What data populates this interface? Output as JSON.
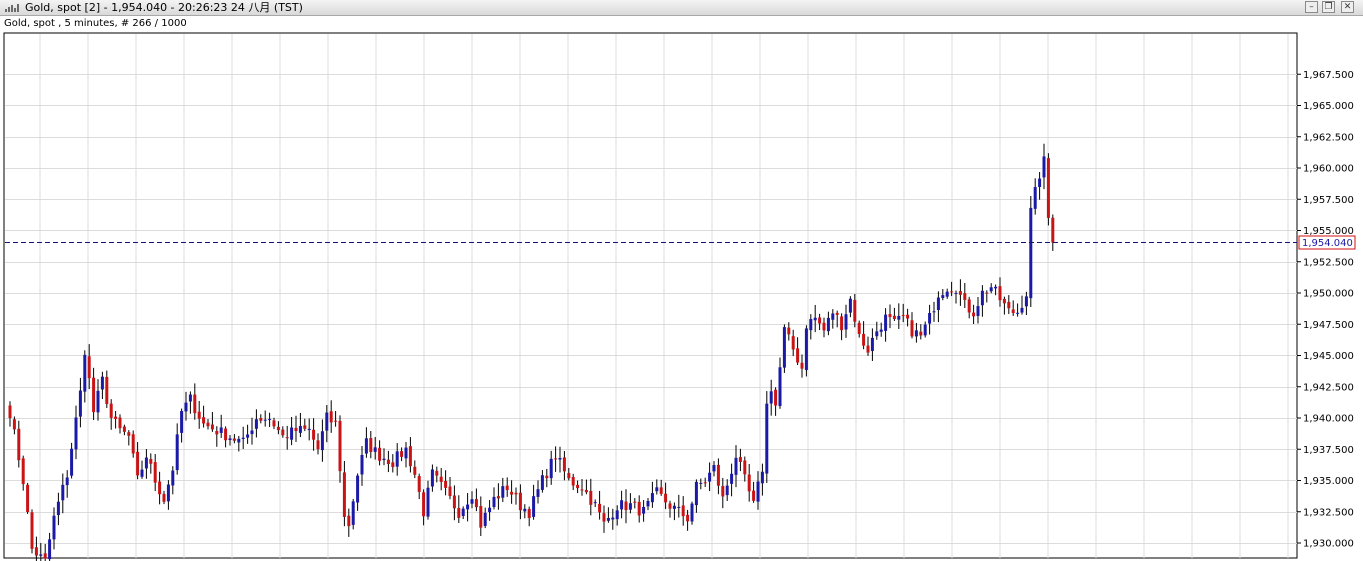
{
  "window": {
    "title": "Gold, spot [2] - 1,954.040 - 20:26:23  24 八月 (TST)",
    "buttons": {
      "minimize": "–",
      "restore": "❐",
      "close": "✕"
    }
  },
  "chart_info": "Gold, spot , 5 minutes, # 266 / 1000",
  "colors": {
    "up": "#1a1aa6",
    "down": "#c81414",
    "grid": "#dcdcdc",
    "last_line": "#14146e",
    "last_label": "#d01010"
  },
  "chart_data": {
    "type": "candlestick",
    "instrument": "Gold, spot",
    "timeframe": "5 minutes",
    "ylim": [
      1928.8,
      1970.8
    ],
    "y_ticks": [
      1930.0,
      1932.5,
      1935.0,
      1937.5,
      1940.0,
      1942.5,
      1945.0,
      1947.5,
      1950.0,
      1952.5,
      1955.0,
      1957.5,
      1960.0,
      1962.5,
      1965.0,
      1967.5
    ],
    "y_tick_labels": [
      "1,930.000",
      "1,932.500",
      "1,935.000",
      "1,937.500",
      "1,940.000",
      "1,942.500",
      "1,945.000",
      "1,947.500",
      "1,950.000",
      "1,952.500",
      "1,955.000",
      "1,957.500",
      "1,960.000",
      "1,962.500",
      "1,965.000",
      "1,967.500"
    ],
    "last_price": 1954.04,
    "last_price_label": "1,954.040",
    "grid": true,
    "checkpoints": [
      [
        0,
        1940.5
      ],
      [
        3,
        1935.0
      ],
      [
        5,
        1929.5
      ],
      [
        8,
        1928.5
      ],
      [
        10,
        1932.0
      ],
      [
        13,
        1935.5
      ],
      [
        16,
        1942.0
      ],
      [
        17,
        1945.5
      ],
      [
        19,
        1940.5
      ],
      [
        21,
        1943.0
      ],
      [
        23,
        1940.0
      ],
      [
        25,
        1939.0
      ],
      [
        27,
        1938.5
      ],
      [
        29,
        1935.0
      ],
      [
        31,
        1937.0
      ],
      [
        33,
        1935.0
      ],
      [
        35,
        1933.5
      ],
      [
        37,
        1936.0
      ],
      [
        39,
        1940.5
      ],
      [
        41,
        1941.5
      ],
      [
        44,
        1939.5
      ],
      [
        47,
        1939.0
      ],
      [
        50,
        1938.5
      ],
      [
        53,
        1938.0
      ],
      [
        56,
        1940.0
      ],
      [
        59,
        1940.0
      ],
      [
        62,
        1938.5
      ],
      [
        65,
        1939.0
      ],
      [
        68,
        1939.0
      ],
      [
        70,
        1937.5
      ],
      [
        72,
        1940.0
      ],
      [
        74,
        1939.5
      ],
      [
        75,
        1936.0
      ],
      [
        76,
        1932.0
      ],
      [
        77,
        1931.5
      ],
      [
        79,
        1935.5
      ],
      [
        81,
        1938.0
      ],
      [
        84,
        1937.0
      ],
      [
        87,
        1936.5
      ],
      [
        90,
        1937.5
      ],
      [
        92,
        1935.5
      ],
      [
        94,
        1932.5
      ],
      [
        96,
        1935.5
      ],
      [
        99,
        1934.0
      ],
      [
        102,
        1932.5
      ],
      [
        105,
        1934.0
      ],
      [
        107,
        1931.5
      ],
      [
        110,
        1933.5
      ],
      [
        113,
        1934.5
      ],
      [
        116,
        1933.0
      ],
      [
        118,
        1932.5
      ],
      [
        121,
        1935.0
      ],
      [
        124,
        1937.0
      ],
      [
        127,
        1935.0
      ],
      [
        130,
        1934.5
      ],
      [
        133,
        1933.0
      ],
      [
        135,
        1931.5
      ],
      [
        138,
        1933.0
      ],
      [
        141,
        1933.0
      ],
      [
        144,
        1932.5
      ],
      [
        147,
        1934.0
      ],
      [
        150,
        1933.0
      ],
      [
        152,
        1932.5
      ],
      [
        154,
        1932.0
      ],
      [
        156,
        1934.5
      ],
      [
        158,
        1935.0
      ],
      [
        160,
        1936.0
      ],
      [
        162,
        1933.5
      ],
      [
        165,
        1937.0
      ],
      [
        167,
        1935.0
      ],
      [
        169,
        1933.0
      ],
      [
        171,
        1936.0
      ],
      [
        172,
        1941.0
      ],
      [
        173,
        1942.5
      ],
      [
        174,
        1941.0
      ],
      [
        175,
        1944.0
      ],
      [
        176,
        1947.0
      ],
      [
        178,
        1945.5
      ],
      [
        180,
        1944.0
      ],
      [
        181,
        1947.5
      ],
      [
        183,
        1948.0
      ],
      [
        185,
        1947.0
      ],
      [
        187,
        1948.5
      ],
      [
        189,
        1947.5
      ],
      [
        191,
        1949.5
      ],
      [
        193,
        1946.5
      ],
      [
        195,
        1945.5
      ],
      [
        197,
        1947.0
      ],
      [
        199,
        1948.0
      ],
      [
        201,
        1947.5
      ],
      [
        203,
        1948.0
      ],
      [
        205,
        1947.0
      ],
      [
        207,
        1946.5
      ],
      [
        209,
        1948.0
      ],
      [
        211,
        1950.0
      ],
      [
        213,
        1950.5
      ],
      [
        215,
        1950.5
      ],
      [
        217,
        1949.0
      ],
      [
        219,
        1948.5
      ],
      [
        221,
        1950.0
      ],
      [
        223,
        1950.5
      ],
      [
        225,
        1949.5
      ],
      [
        227,
        1948.5
      ],
      [
        229,
        1948.5
      ],
      [
        231,
        1950.0
      ],
      [
        232,
        1956.5
      ],
      [
        233,
        1958.0
      ],
      [
        234,
        1959.5
      ],
      [
        235,
        1960.5
      ],
      [
        236,
        1956.0
      ],
      [
        237,
        1954.0
      ]
    ]
  }
}
